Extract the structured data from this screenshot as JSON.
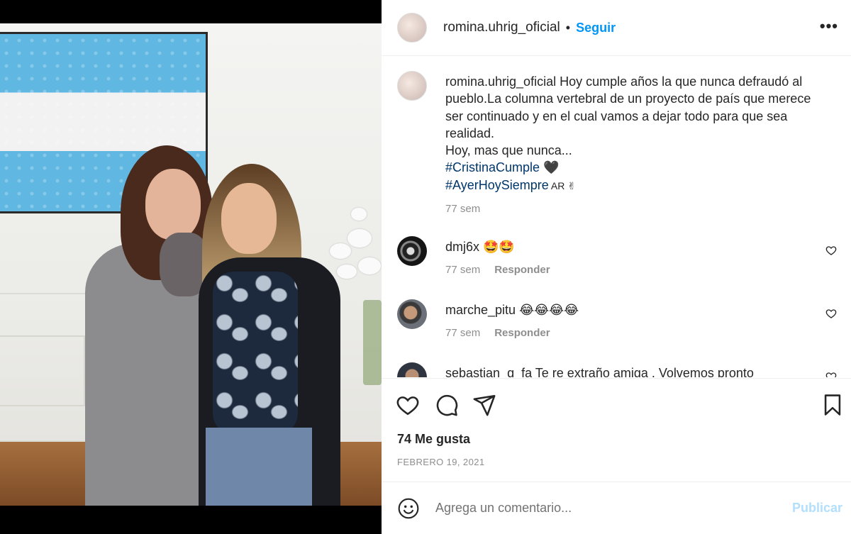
{
  "post": {
    "username": "romina.uhrig_oficial",
    "dot": "•",
    "follow_label": "Seguir",
    "more_label": "•••"
  },
  "caption": {
    "username": "romina.uhrig_oficial",
    "text": " Hoy cumple años la que nunca defraudó al pueblo.La columna vertebral de un proyecto de país que merece ser continuado y en el cual vamos a dejar todo para que sea realidad.",
    "line2": "Hoy, mas que nunca...",
    "hashtag1": "#CristinaCumple",
    "hashtag1_suffix": " 🖤",
    "hashtag2": "#AyerHoySiempre",
    "hashtag2_suffix": " AR ✌",
    "time": "77 sem"
  },
  "comments": [
    {
      "username": "dmj6x",
      "text": " 🤩🤩",
      "time": "77 sem",
      "reply": "Responder"
    },
    {
      "username": "marche_pitu",
      "text": " 😂😂😂😂",
      "time": "77 sem",
      "reply": "Responder"
    },
    {
      "username": "sebastian_g_fa",
      "text": " Te re extraño amiga . Volvemos pronto",
      "time": "",
      "reply": ""
    }
  ],
  "likes": "74 Me gusta",
  "date": "FEBRERO 19, 2021",
  "composer": {
    "placeholder": "Agrega un comentario...",
    "publish_label": "Publicar"
  },
  "colors": {
    "accent": "#0095f6",
    "hashtag": "#00376b",
    "muted": "#8e8e8e",
    "publish_disabled": "#b2dffc"
  }
}
